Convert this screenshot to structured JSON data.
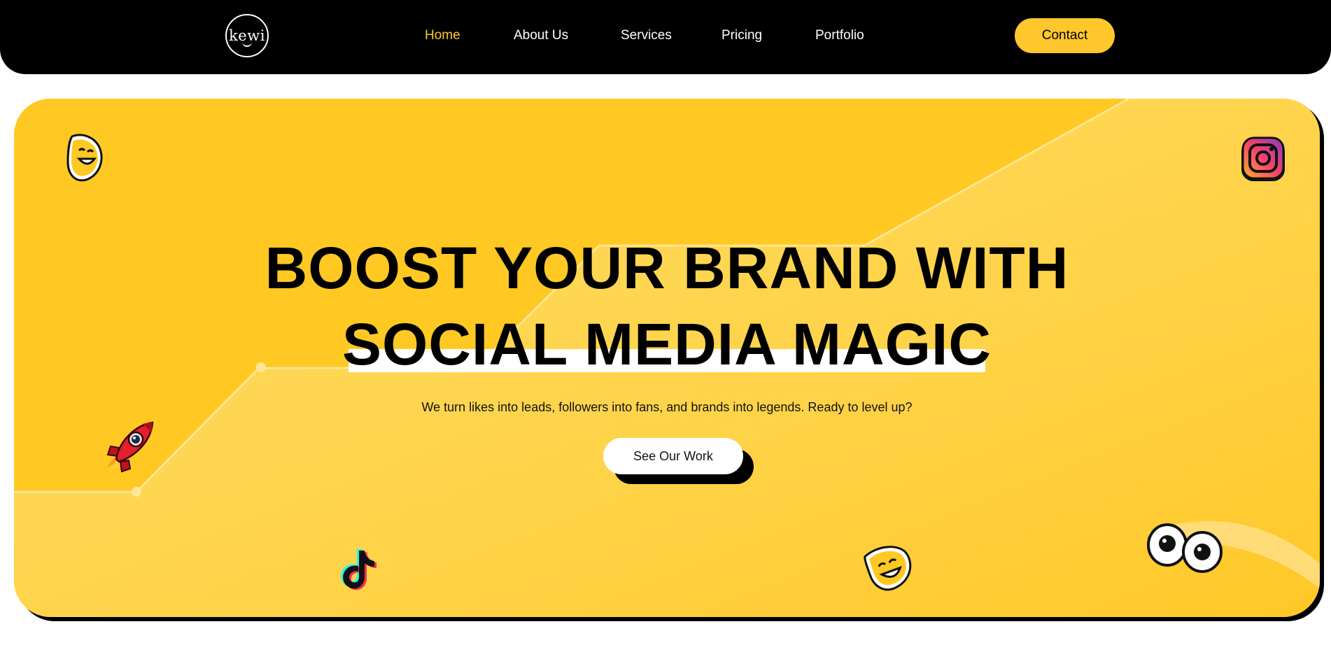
{
  "nav": {
    "logo_text": "kewi",
    "links": [
      {
        "label": "Home",
        "active": true
      },
      {
        "label": "About Us",
        "active": false
      },
      {
        "label": "Services",
        "active": false
      },
      {
        "label": "Pricing",
        "active": false
      },
      {
        "label": "Portfolio",
        "active": false
      }
    ],
    "contact_label": "Contact"
  },
  "hero": {
    "headline_line1": "BOOST YOUR BRAND WITH",
    "headline_line2": "SOCIAL MEDIA MAGIC",
    "subtitle": "We turn likes into leads, followers into fans, and brands into legends. Ready to level up?",
    "cta_label": "See Our Work"
  },
  "icons": [
    "smiley-mask-icon",
    "instagram-icon",
    "rocket-icon",
    "tiktok-icon",
    "googly-eyes-icon"
  ],
  "colors": {
    "accent": "#ffc72c",
    "hero_bg": "#ffc823",
    "nav_bg": "#000000"
  }
}
